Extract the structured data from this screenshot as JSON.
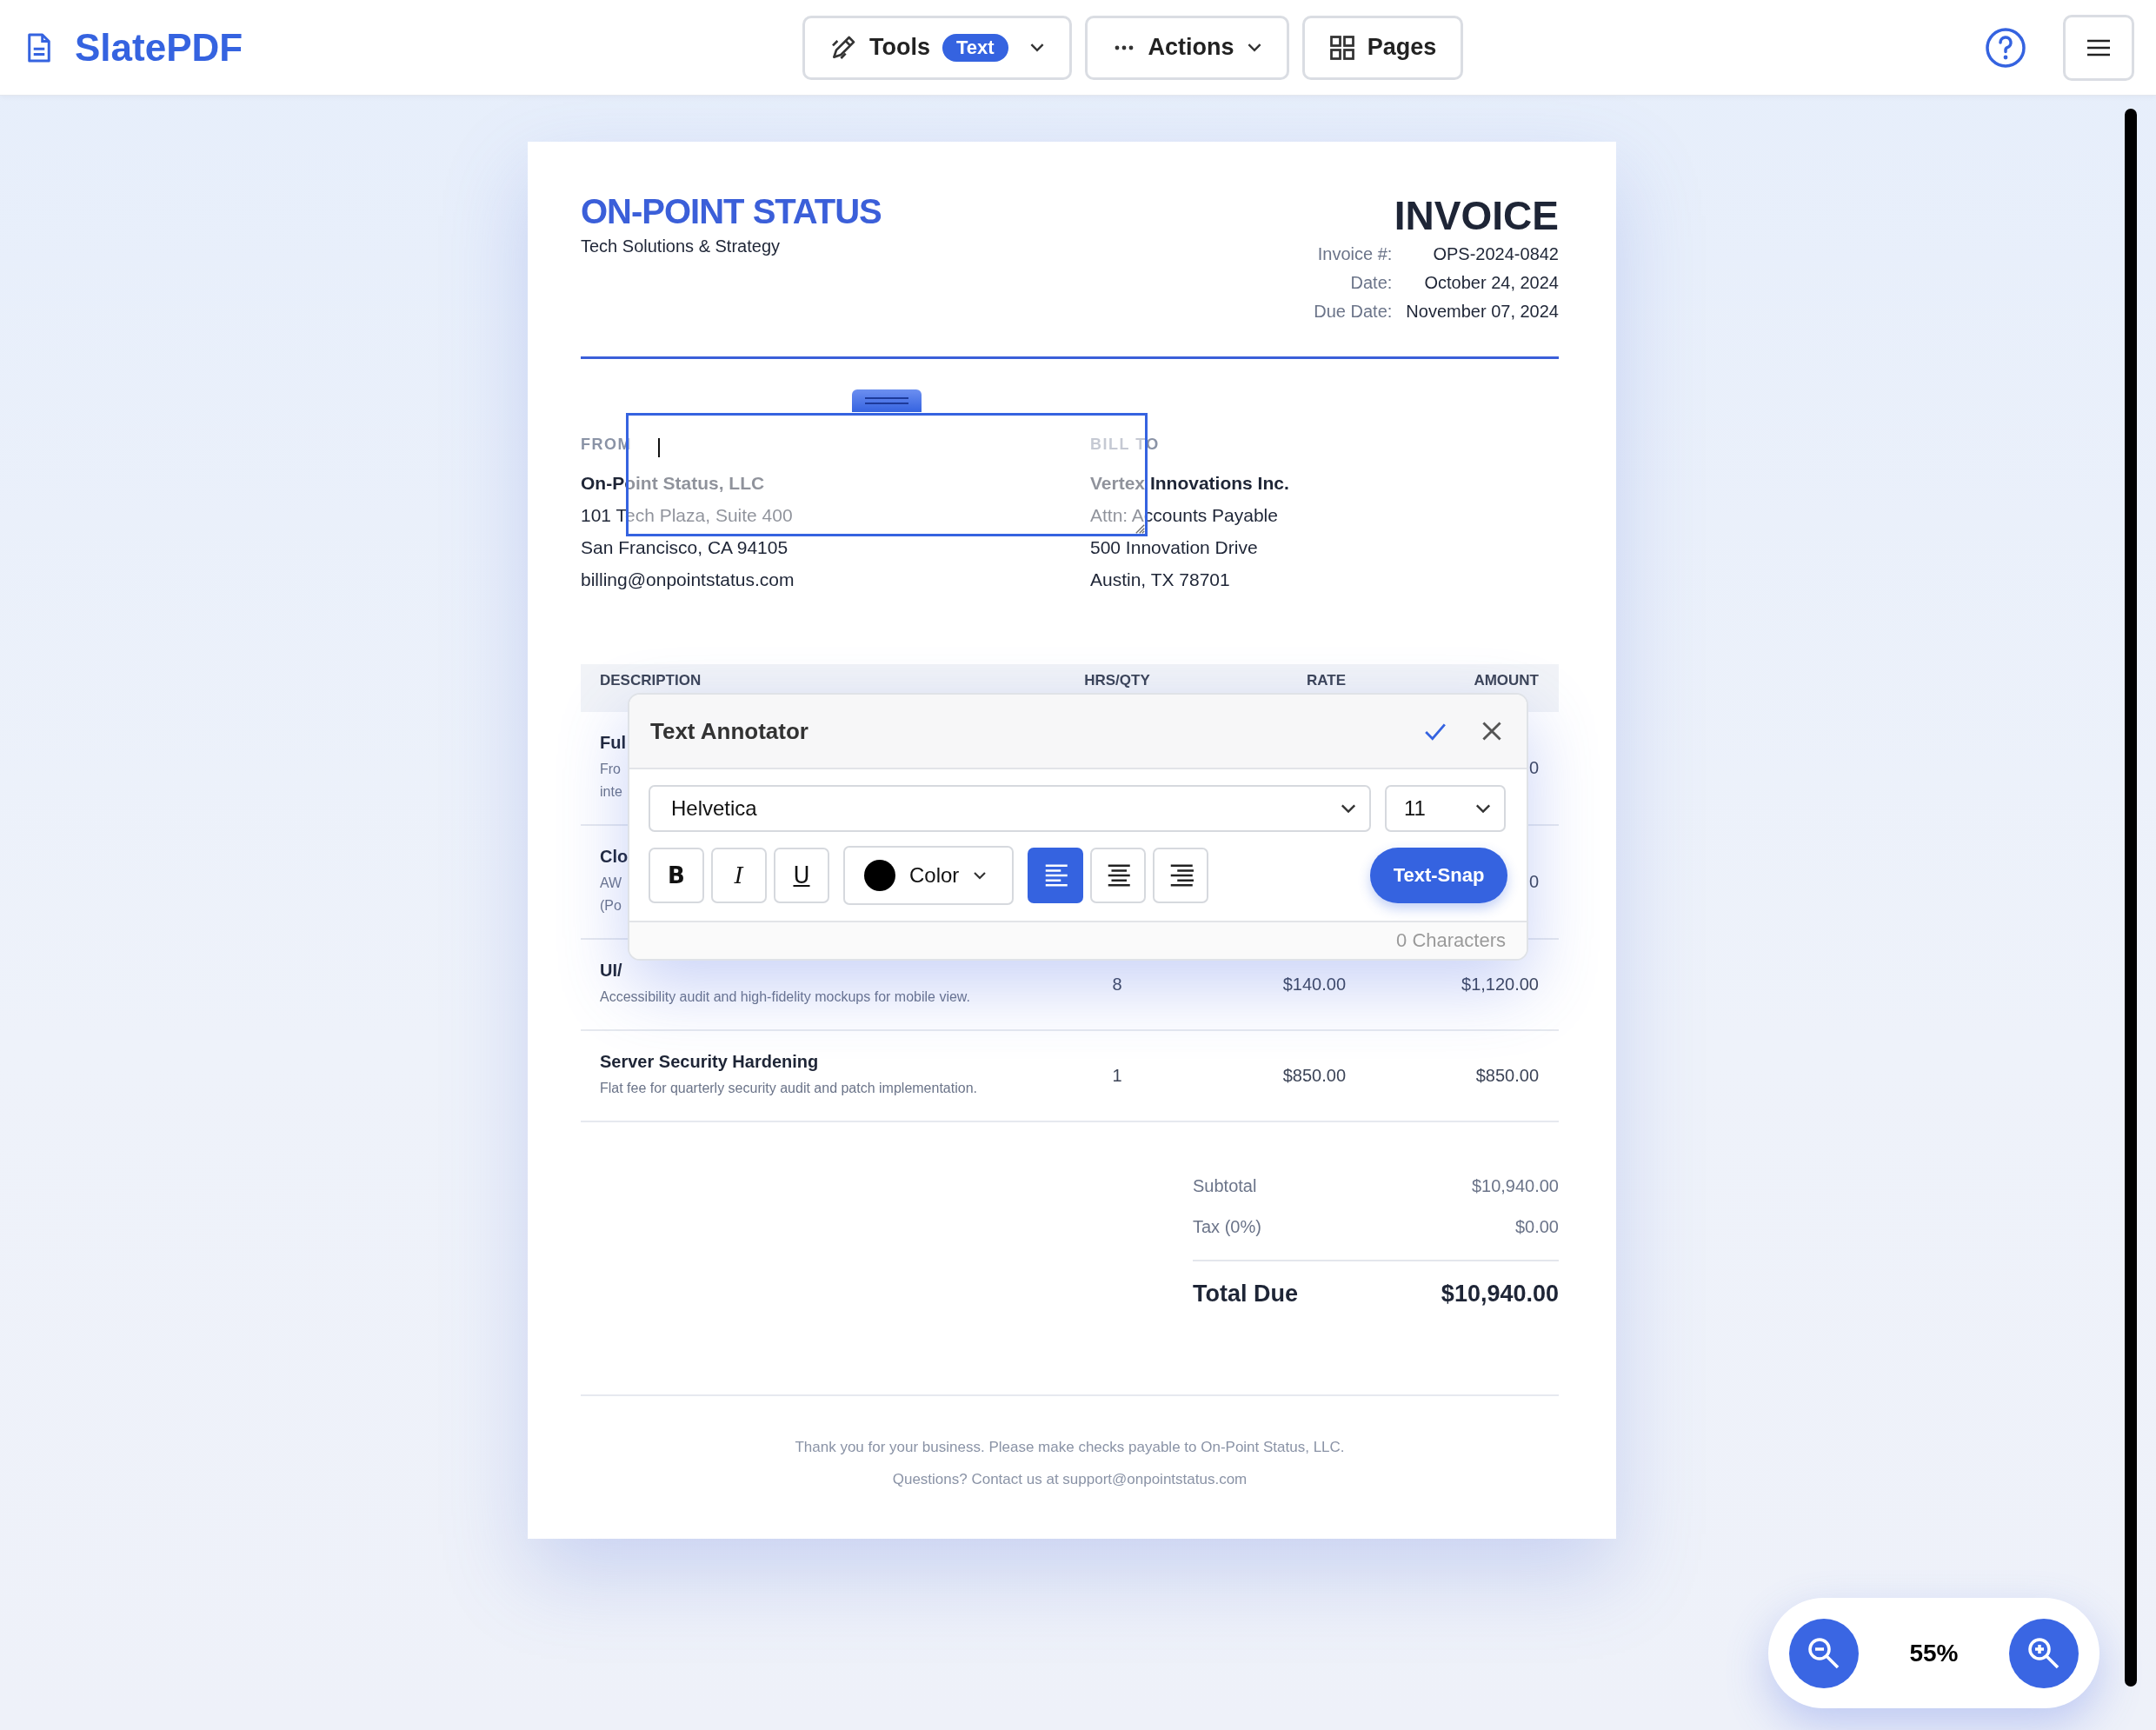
{
  "app": {
    "name": "SlatePDF"
  },
  "toolbar": [
    {
      "kind": "tools",
      "label": "Tools",
      "badge": "Text"
    },
    {
      "kind": "actions",
      "label": "Actions"
    },
    {
      "kind": "pages",
      "label": "Pages"
    }
  ],
  "invoice": {
    "company": "ON-POINT STATUS",
    "tagline": "Tech Solutions & Strategy",
    "title": "INVOICE",
    "meta": [
      {
        "label": "Invoice #:",
        "value": "OPS-2024-0842"
      },
      {
        "label": "Date:",
        "value": "October 24, 2024"
      },
      {
        "label": "Due Date:",
        "value": "November 07, 2024"
      }
    ],
    "parties": [
      {
        "heading": "FROM",
        "name": "On-Point Status, LLC",
        "lines": [
          "101 Tech Plaza, Suite 400",
          "San Francisco, CA 94105",
          "billing@onpointstatus.com"
        ]
      },
      {
        "heading": "BILL TO",
        "name": "Vertex Innovations Inc.",
        "lines": [
          "Attn: Accounts Payable",
          "500 Innovation Drive",
          "Austin, TX 78701"
        ]
      }
    ],
    "table": {
      "columns": [
        "DESCRIPTION",
        "HRS/QTY",
        "RATE",
        "AMOUNT"
      ],
      "rows": [
        {
          "title": "Ful",
          "desc_lines": [
            "Fro",
            "inte"
          ],
          "amount": "0"
        },
        {
          "title": "Clo",
          "desc_lines": [
            "AW",
            "(Po"
          ],
          "amount": "0"
        },
        {
          "title": "UI/",
          "desc_lines": [
            "Accessibility audit and high-fidelity mockups for mobile view."
          ],
          "qty": "8",
          "rate": "$140.00",
          "amount": "$1,120.00"
        },
        {
          "title": "Server Security Hardening",
          "desc_lines": [
            "Flat fee for quarterly security audit and patch implementation."
          ],
          "qty": "1",
          "rate": "$850.00",
          "amount": "$850.00"
        }
      ]
    },
    "totals": [
      {
        "label": "Subtotal",
        "value": "$10,940.00",
        "kind": "line"
      },
      {
        "label": "Tax (0%)",
        "value": "$0.00",
        "kind": "line"
      },
      {
        "label": "Total Due",
        "value": "$10,940.00",
        "kind": "grand"
      }
    ],
    "footer": [
      "Thank you for your business. Please make checks payable to On-Point Status, LLC.",
      "Questions? Contact us at support@onpointstatus.com"
    ]
  },
  "annotator": {
    "title": "Text Annotator",
    "font": "Helvetica",
    "size": "11",
    "styles": [
      {
        "kind": "bold",
        "label": "B",
        "selected": false
      },
      {
        "kind": "italic",
        "label": "I",
        "selected": false
      },
      {
        "kind": "underline",
        "label": "U",
        "selected": false
      }
    ],
    "color": {
      "label": "Color",
      "color": "#000000"
    },
    "align": [
      {
        "kind": "left",
        "selected": true
      },
      {
        "kind": "center",
        "selected": false
      },
      {
        "kind": "right",
        "selected": false
      }
    ],
    "action": "Text-Snap",
    "count": "0 Characters"
  },
  "zoom": {
    "reading": "55%"
  }
}
